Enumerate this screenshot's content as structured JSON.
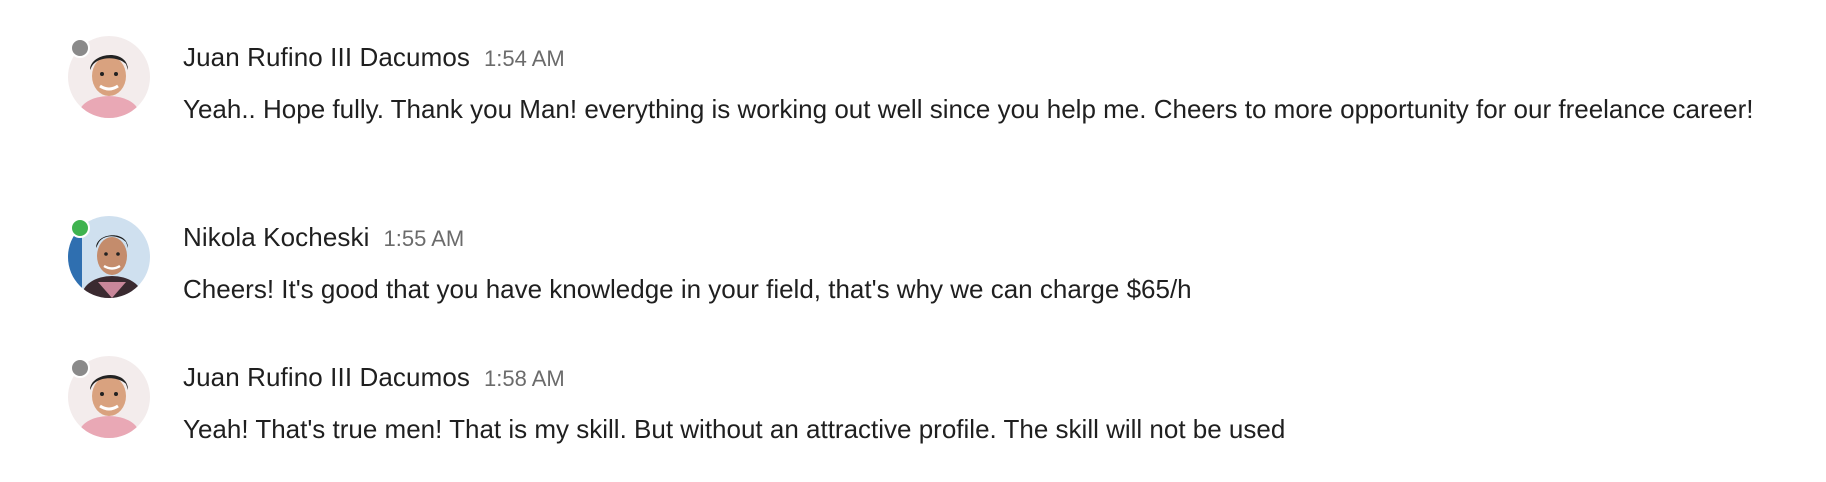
{
  "messages": [
    {
      "sender": "Juan Rufino III Dacumos",
      "time": "1:54 AM",
      "text": "Yeah.. Hope fully. Thank you Man! everything is working out well since you help me. Cheers to more opportunity for our freelance career!",
      "presence": "offline",
      "presence_color": "#8a8a8a"
    },
    {
      "sender": "Nikola Kocheski",
      "time": "1:55 AM",
      "text": "Cheers! It's good that you have knowledge in your field, that's why we can charge $65/h",
      "presence": "online",
      "presence_color": "#3fb34f"
    },
    {
      "sender": "Juan Rufino III Dacumos",
      "time": "1:58 AM",
      "text": "Yeah! That's true men! That is my skill. But without an attractive profile. The skill will not be used",
      "presence": "offline",
      "presence_color": "#8a8a8a"
    }
  ],
  "icons": {
    "avatar_1": "avatar-juan-icon",
    "avatar_2": "avatar-nikola-icon",
    "avatar_3": "avatar-juan-icon"
  }
}
